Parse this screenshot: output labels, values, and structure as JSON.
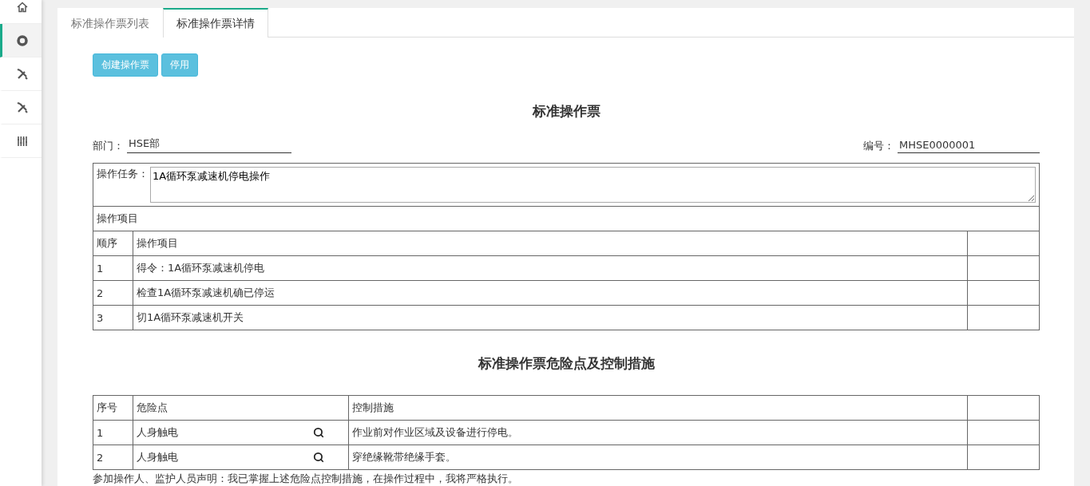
{
  "sidebar": {
    "items": [
      {
        "kind": "home",
        "selected": false
      },
      {
        "kind": "ring",
        "selected": true
      },
      {
        "kind": "tools",
        "selected": false
      },
      {
        "kind": "tools",
        "selected": false
      },
      {
        "kind": "bars",
        "selected": false
      }
    ]
  },
  "tabs": [
    {
      "label": "标准操作票列表",
      "selected": false
    },
    {
      "label": "标准操作票详情",
      "selected": true
    }
  ],
  "buttons": [
    "创建操作票",
    "停用"
  ],
  "title": "标准操作票",
  "department": {
    "label": "部门：",
    "value": "HSE部"
  },
  "number": {
    "label": "编号：",
    "value": "MHSE0000001"
  },
  "task": {
    "label": "操作任务：",
    "value": "1A循环泵减速机停电操作"
  },
  "items_section": {
    "title": "操作项目",
    "columns": [
      "顺序",
      "操作项目"
    ],
    "rows": [
      [
        "1",
        "得令：1A循环泵减速机停电"
      ],
      [
        "2",
        "检查1A循环泵减速机确已停运"
      ],
      [
        "3",
        "切1A循环泵减速机开关"
      ]
    ]
  },
  "risk_title": "标准操作票危险点及控制措施",
  "risks": {
    "columns": [
      "序号",
      "危险点",
      "控制措施"
    ],
    "rows": [
      [
        "1",
        "人身触电",
        "作业前对作业区域及设备进行停电。"
      ],
      [
        "2",
        "人身触电",
        "穿绝缘靴带绝缘手套。"
      ]
    ]
  },
  "declaration": "参加操作人、监护人员声明：我已掌握上述危险点控制措施，在操作过程中，我将严格执行。"
}
